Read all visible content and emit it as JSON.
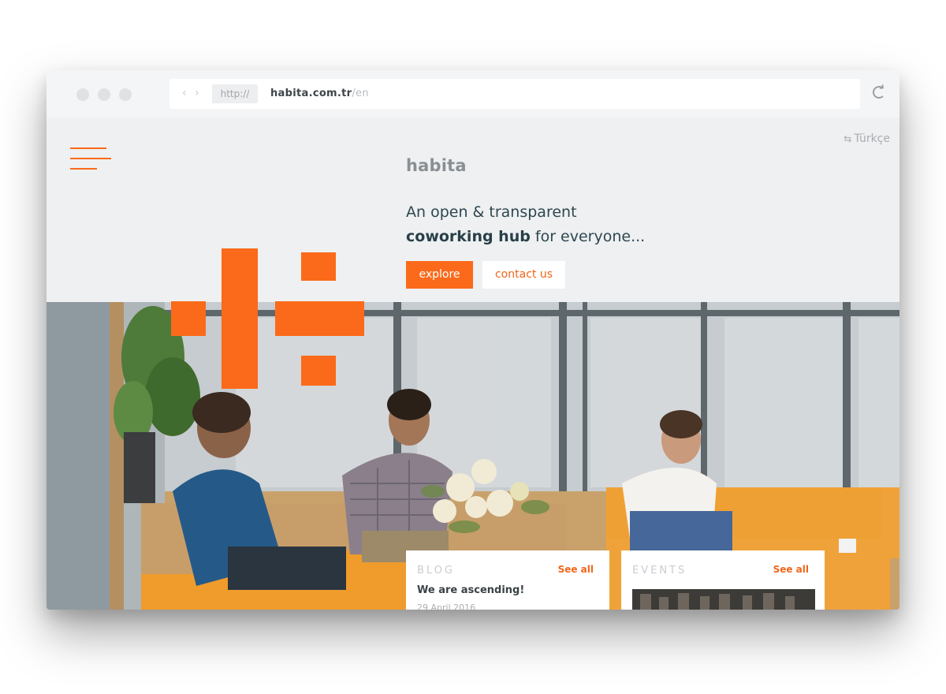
{
  "browser": {
    "url_protocol": "http://",
    "url_domain": "habita.com.tr",
    "url_path": "/en",
    "back_icon": "chevron-left-icon",
    "forward_icon": "chevron-right-icon",
    "reload_icon": "reload-icon"
  },
  "header": {
    "language_label": "Türkçe",
    "language_icon": "swap-arrows-icon",
    "logo_text": "habita",
    "menu_icon": "hamburger-menu-icon"
  },
  "hero": {
    "headline_line1": "An open & transparent",
    "headline_bold": "coworking hub",
    "headline_rest": " for everyone...",
    "explore_label": "explore",
    "contact_label": "contact us"
  },
  "cards": {
    "blog": {
      "label": "BLOG",
      "see_all": "See all",
      "title": "We are ascending!",
      "date": "29 April 2016"
    },
    "events": {
      "label": "EVENTS",
      "see_all": "See all"
    }
  },
  "colors": {
    "accent": "#fb6a1a",
    "page_bg": "#eef0f1",
    "heading": "#2e4650"
  }
}
